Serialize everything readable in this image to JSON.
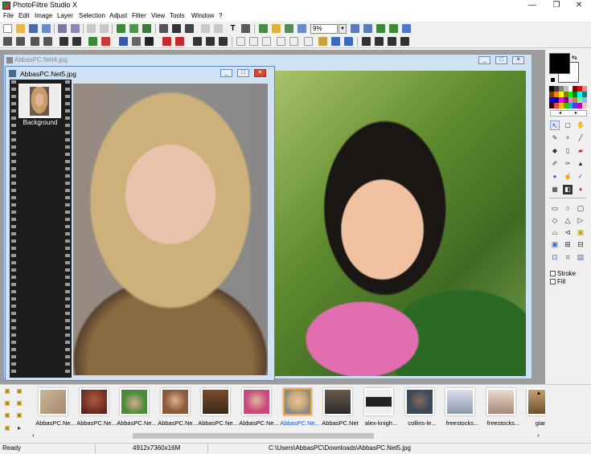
{
  "app": {
    "title": "PhotoFiltre Studio X",
    "minimize": "—",
    "maximize": "❐",
    "close": "✕"
  },
  "menu": [
    "File",
    "Edit",
    "Image",
    "Layer",
    "Selection",
    "Adjust",
    "Filter",
    "View",
    "Tools",
    "Window",
    "?"
  ],
  "toolbar": {
    "zoom_value": "9%"
  },
  "windows": {
    "back": {
      "title": "AbbasPC.Net4.jpg"
    },
    "front": {
      "title": "AbbasPC.Net5.jpg",
      "layer_label": "Background"
    }
  },
  "tools": {
    "stroke_label": "Stroke",
    "fill_label": "Fill",
    "palette": [
      "#000000",
      "#404040",
      "#808080",
      "#c0c0c0",
      "#ffffff",
      "#800000",
      "#ff0000",
      "#ff8080",
      "#804000",
      "#ff8000",
      "#ffff00",
      "#808000",
      "#00ff00",
      "#008000",
      "#00ffff",
      "#008080",
      "#0000ff",
      "#000080",
      "#ff00ff",
      "#800080",
      "#ff80c0",
      "#c08040",
      "#80ff80",
      "#80c0ff",
      "#400000",
      "#ff4040",
      "#ffc000",
      "#40c000",
      "#00c0c0",
      "#4040ff",
      "#c000c0",
      "#ffc0c0"
    ]
  },
  "browser": {
    "thumbnails": [
      {
        "label": "AbbasPC.Ne..."
      },
      {
        "label": "AbbasPC.Ne..."
      },
      {
        "label": "AbbasPC.Ne..."
      },
      {
        "label": "AbbasPC.Ne..."
      },
      {
        "label": "AbbasPC.Ne..."
      },
      {
        "label": "AbbasPC.Ne..."
      },
      {
        "label": "AbbasPC.Ne...",
        "selected": true
      },
      {
        "label": "AbbasPC.Net"
      },
      {
        "label": "alex-knigh..."
      },
      {
        "label": "collins-le..."
      },
      {
        "label": "freestocks..."
      },
      {
        "label": "freestocks..."
      },
      {
        "label": "gian-c"
      }
    ]
  },
  "status": {
    "state": "Ready",
    "dimensions": "4912x7360x16M",
    "path": "C:\\Users\\AbbasPC\\Downloads\\AbbasPC.Net5.jpg"
  }
}
